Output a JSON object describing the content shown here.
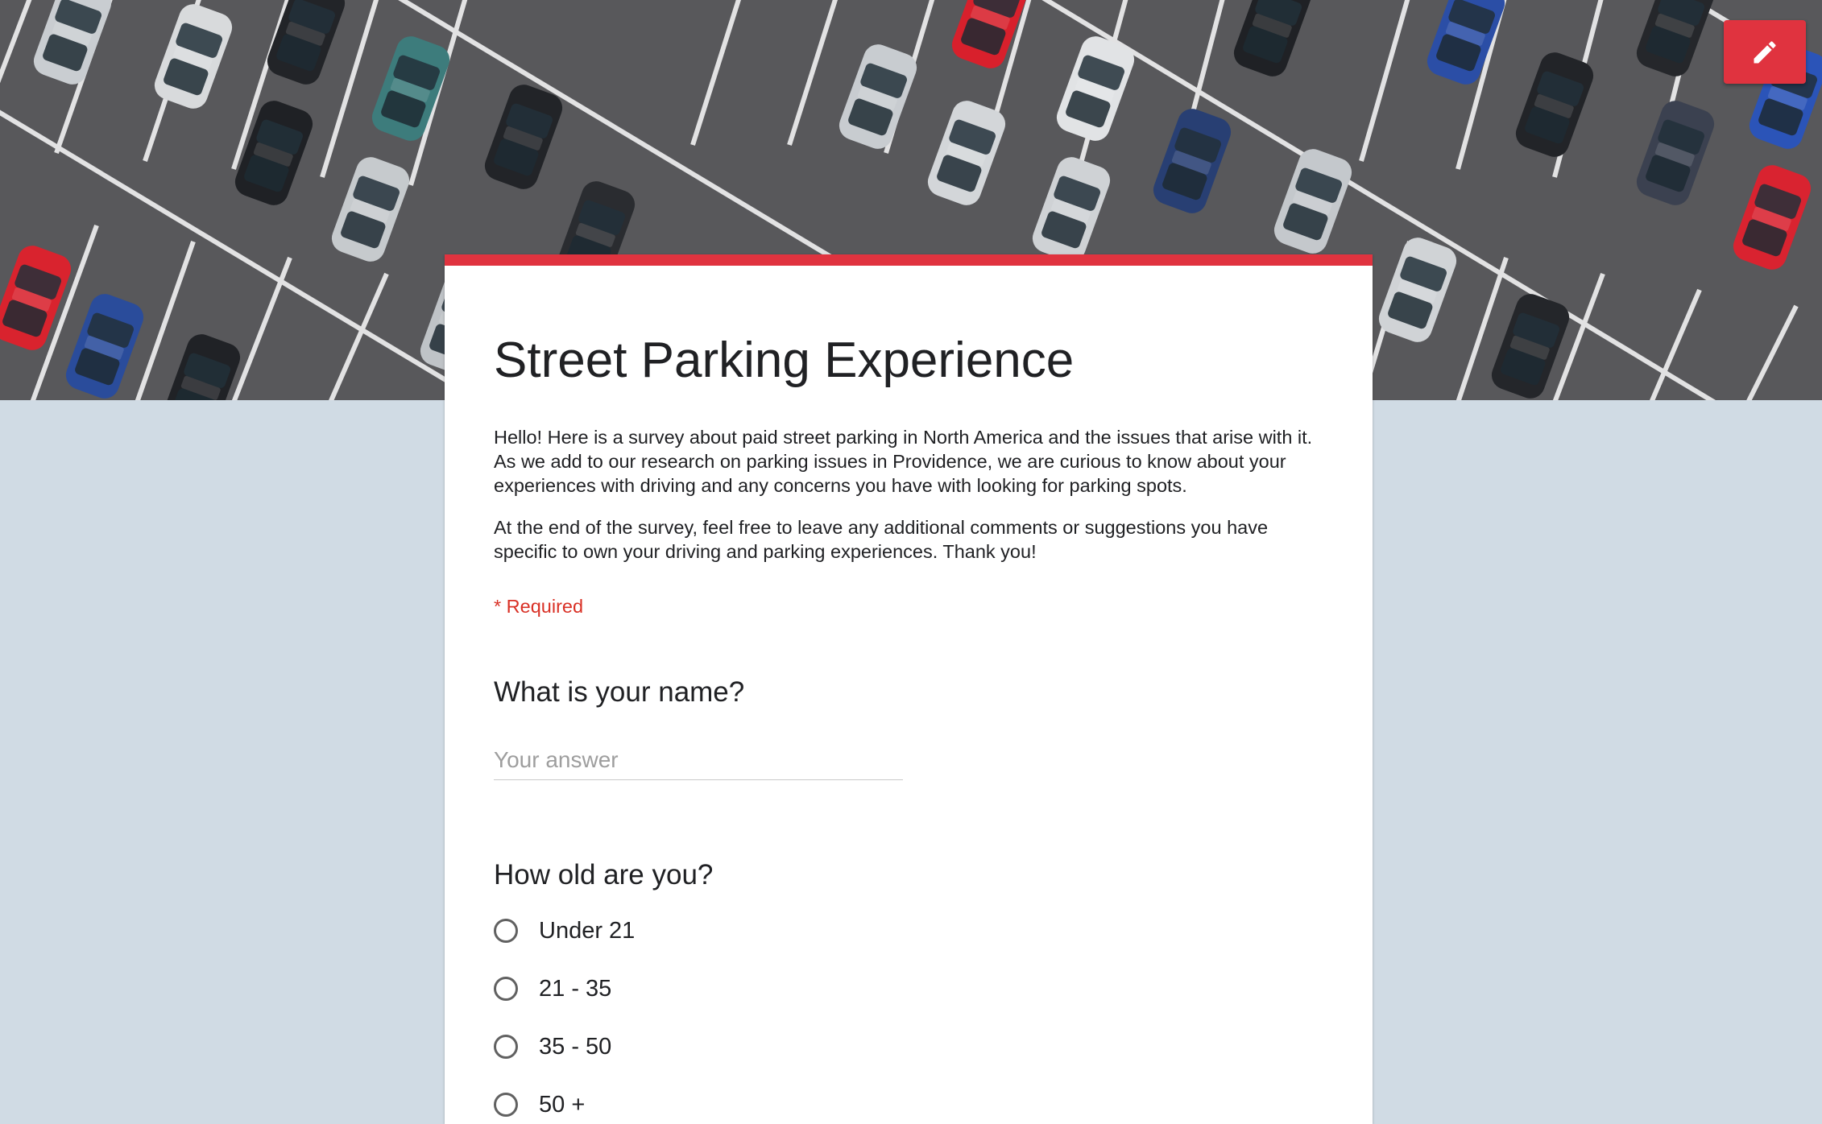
{
  "header": {
    "image_icon": "parking-lot-photo",
    "edit_icon": "pencil-icon"
  },
  "colors": {
    "accent": "#e0333f",
    "background": "#d0dbe4",
    "required": "#d93025"
  },
  "form": {
    "title": "Street Parking Experience",
    "description": [
      "Hello! Here is a survey about paid street parking in North America and the issues that arise with it. As we add to our research on parking issues in Providence, we are curious to know about your experiences with driving and any concerns you have with looking for parking spots.",
      "At the end of the survey, feel free to leave any additional comments or suggestions you have specific to own your driving and parking experiences. Thank you!"
    ],
    "required_note": "* Required",
    "questions": [
      {
        "title": "What is your name?",
        "type": "short-answer",
        "placeholder": "Your answer"
      },
      {
        "title": "How old are you?",
        "type": "radio",
        "options": [
          "Under 21",
          "21 - 35",
          "35 - 50",
          "50 +"
        ]
      }
    ]
  }
}
